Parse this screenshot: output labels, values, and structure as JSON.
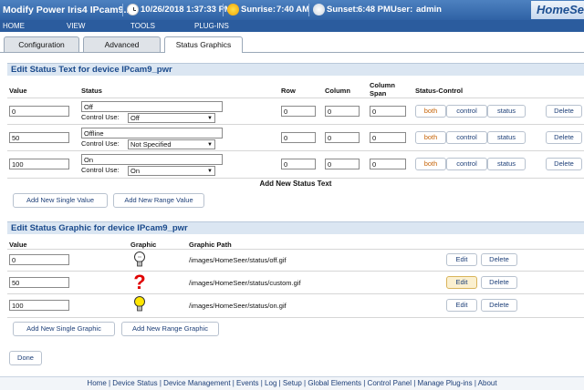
{
  "header": {
    "title": "Modify Power Iris4 IPcam9...",
    "datetime": "10/26/2018 1:37:33 PM",
    "sunrise_label": "Sunrise:",
    "sunrise": "7:40 AM",
    "sunset_label": "Sunset:",
    "sunset": "6:48 PM",
    "user_label": "User:",
    "user": "admin",
    "logo": "HomeSe"
  },
  "menu": [
    "HOME",
    "VIEW",
    "TOOLS",
    "PLUG-INS"
  ],
  "tabs": [
    {
      "label": "Configuration",
      "active": false
    },
    {
      "label": "Advanced",
      "active": false
    },
    {
      "label": "Status Graphics",
      "active": true
    }
  ],
  "status_text": {
    "title": "Edit Status Text for device IPcam9_pwr",
    "columns": [
      "Value",
      "Status",
      "Row",
      "Column",
      "Column Span",
      "Status-Control"
    ],
    "control_use_label": "Control Use:",
    "rows": [
      {
        "value": "0",
        "status": "Off",
        "control_use": "Off",
        "row": "0",
        "column": "0",
        "span": "0"
      },
      {
        "value": "50",
        "status": "Offline",
        "control_use": "Not Specified",
        "row": "0",
        "column": "0",
        "span": "0"
      },
      {
        "value": "100",
        "status": "On",
        "control_use": "On",
        "row": "0",
        "column": "0",
        "span": "0"
      }
    ],
    "btn_both": "both",
    "btn_control": "control",
    "btn_status": "status",
    "btn_delete": "Delete",
    "add_caption": "Add New Status Text",
    "add_single": "Add New Single Value",
    "add_range": "Add New Range Value"
  },
  "status_graphic": {
    "title": "Edit Status Graphic for device IPcam9_pwr",
    "columns": [
      "Value",
      "Graphic",
      "Graphic Path"
    ],
    "rows": [
      {
        "value": "0",
        "icon": "bulb-off-icon",
        "path": "/images/HomeSeer/status/off.gif"
      },
      {
        "value": "50",
        "icon": "red-question-mark-icon",
        "path": "/images/HomeSeer/status/custom.gif"
      },
      {
        "value": "100",
        "icon": "bulb-on-icon",
        "path": "/images/HomeSeer/status/on.gif"
      }
    ],
    "btn_edit": "Edit",
    "btn_delete": "Delete",
    "add_single": "Add New Single Graphic",
    "add_range": "Add New Range Graphic"
  },
  "done": "Done",
  "footer": "Home | Device Status | Device Management | Events | Log | Setup | Global Elements | Control Panel | Manage Plug-ins | About",
  "colors": {
    "accent": "#2b5c9e",
    "section_header": "#dbe6f2",
    "orange": "#c7660c"
  }
}
